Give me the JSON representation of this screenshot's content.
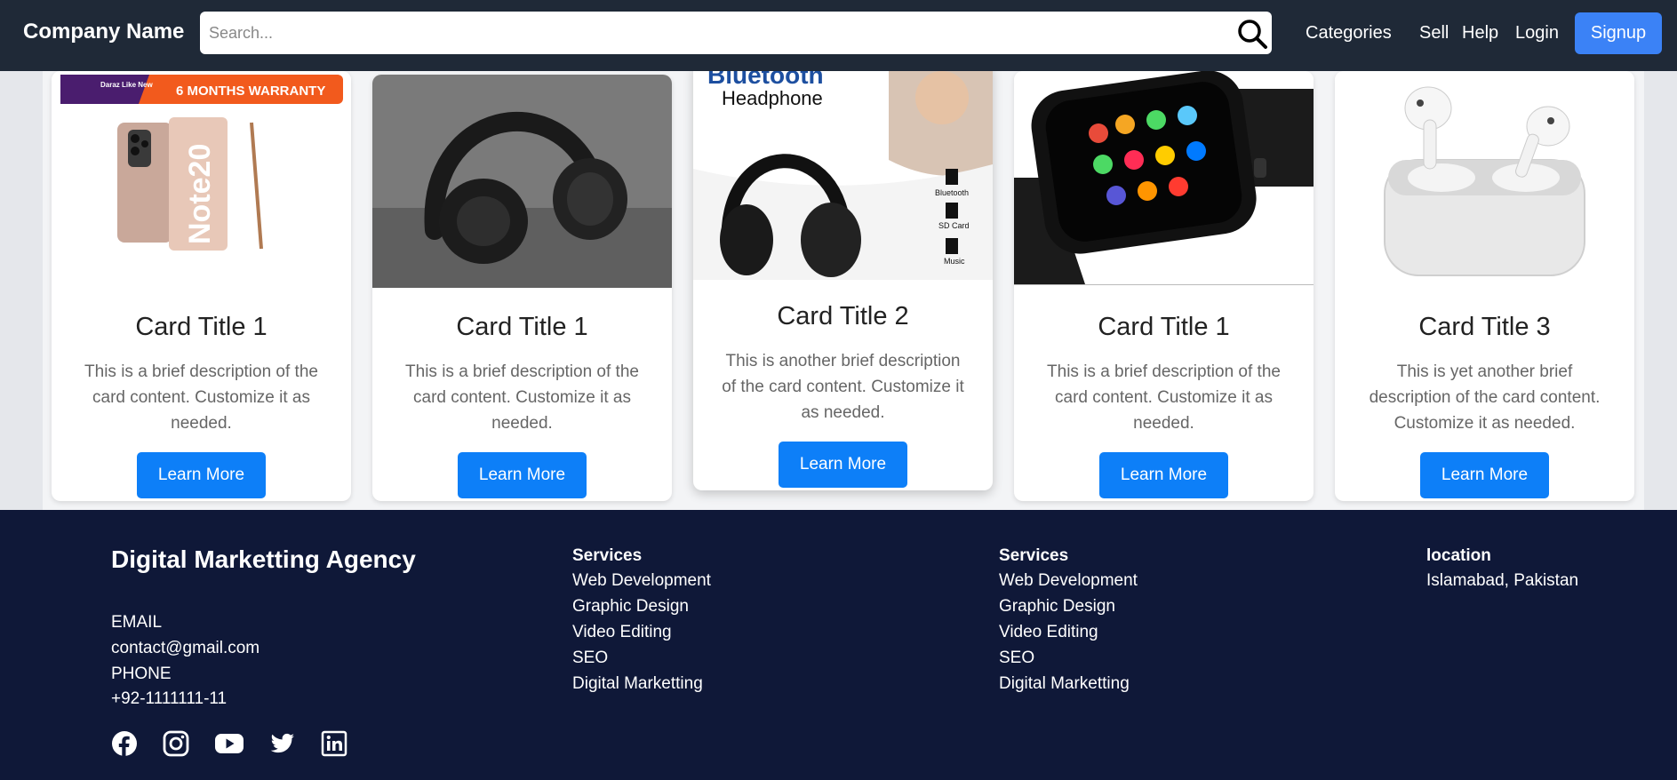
{
  "navbar": {
    "brand": "Company Name",
    "search_placeholder": "Search...",
    "links": [
      "Categories",
      "Sell",
      "Help",
      "Login"
    ],
    "signup": "Signup"
  },
  "cards": [
    {
      "title": "Card Title 1",
      "description": "This is a brief description of the card content. Customize it as needed.",
      "button": "Learn More",
      "image": "phone-warranty-image",
      "image_texts": {
        "brand": "Daraz Like New",
        "banner": "6 MONTHS WARRANTY",
        "model": "Note20"
      }
    },
    {
      "title": "Card Title 1",
      "description": "This is a brief description of the card content. Customize it as needed.",
      "button": "Learn More",
      "image": "headphones-photo"
    },
    {
      "title": "Card Title 2",
      "description": "This is another brief description of the card content. Customize it as needed.",
      "button": "Learn More",
      "image": "bluetooth-headphone-ad",
      "image_texts": {
        "heading": "Bluetooth",
        "subheading": "Headphone",
        "features": [
          "Bluetooth",
          "SD Card",
          "Music"
        ]
      }
    },
    {
      "title": "Card Title 1",
      "description": "This is a brief description of the card content. Customize it as needed.",
      "button": "Learn More",
      "image": "smartwatch-photo"
    },
    {
      "title": "Card Title 3",
      "description": "This is yet another brief description of the card content. Customize it as needed.",
      "button": "Learn More",
      "image": "airpods-photo"
    }
  ],
  "footer": {
    "agency": "Digital Marketting Agency",
    "email_label": "EMAIL",
    "email": "contact@gmail.com",
    "phone_label": "PHONE",
    "phone": "+92-1111111-11",
    "services_1": {
      "heading": "Services",
      "items": [
        "Web Development",
        "Graphic Design",
        "Video Editing",
        "SEO",
        "Digital Marketting"
      ]
    },
    "services_2": {
      "heading": "Services",
      "items": [
        "Web Development",
        "Graphic Design",
        "Video Editing",
        "SEO",
        "Digital Marketting"
      ]
    },
    "location_heading": "location",
    "location": "Islamabad, Pakistan",
    "socials": [
      "facebook-icon",
      "instagram-icon",
      "youtube-icon",
      "twitter-icon",
      "linkedin-icon"
    ]
  },
  "colors": {
    "navbar": "#1f2937",
    "signup": "#3b82f6",
    "card_button": "#0d7ff8",
    "footer": "#0f1838"
  }
}
